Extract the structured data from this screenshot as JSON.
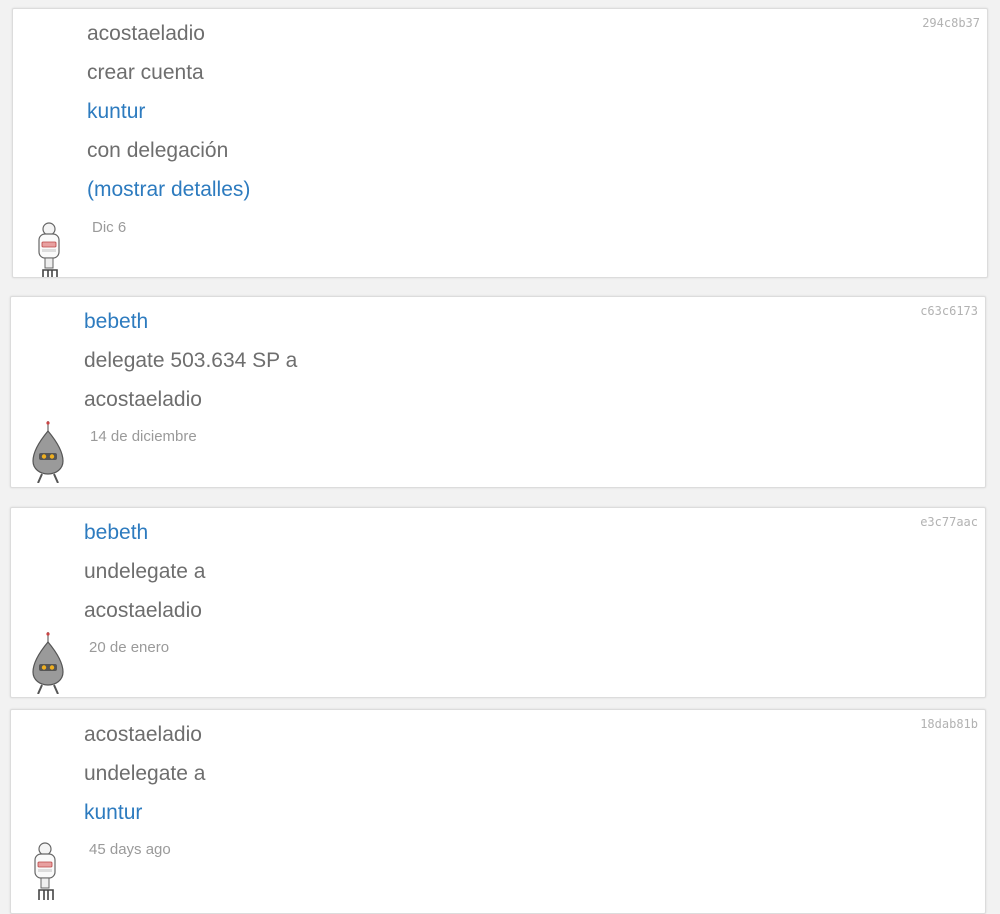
{
  "feed": [
    {
      "hash": "294c8b37",
      "lines": [
        {
          "text": "acostaeladio",
          "link": false
        },
        {
          "text": "crear cuenta",
          "link": false
        },
        {
          "text": "kuntur",
          "link": true
        },
        {
          "text": "con delegación",
          "link": false
        },
        {
          "text": "(mostrar detalles)",
          "link": true
        }
      ],
      "date": "Dic 6",
      "avatar": "white-robot-avatar"
    },
    {
      "hash": "c63c6173",
      "lines": [
        {
          "text": "bebeth",
          "link": true
        },
        {
          "text": "delegate 503.634 SP a",
          "link": false
        },
        {
          "text": "acostaeladio",
          "link": false
        }
      ],
      "date": "14 de diciembre",
      "avatar": "gray-robot-avatar"
    },
    {
      "hash": "e3c77aac",
      "lines": [
        {
          "text": "bebeth",
          "link": true
        },
        {
          "text": "undelegate a",
          "link": false
        },
        {
          "text": "acostaeladio",
          "link": false
        }
      ],
      "date": "20 de enero",
      "avatar": "gray-robot-avatar"
    },
    {
      "hash": "18dab81b",
      "lines": [
        {
          "text": "acostaeladio",
          "link": false
        },
        {
          "text": "undelegate a",
          "link": false
        },
        {
          "text": "kuntur",
          "link": true
        }
      ],
      "date": "45 days ago",
      "avatar": "white-robot-avatar"
    }
  ],
  "colors": {
    "link": "#2d7bbf",
    "text": "#6e6e6e",
    "date": "#9a9a9a",
    "hash": "#b2b2b2"
  }
}
